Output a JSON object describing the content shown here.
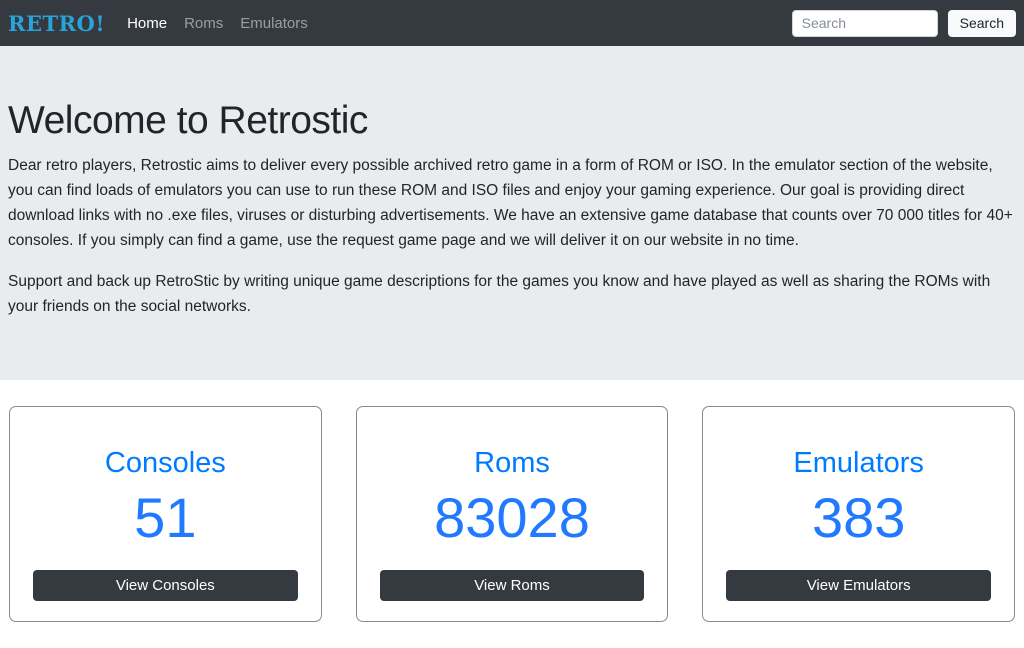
{
  "navbar": {
    "logo": "RETRO!",
    "links": [
      {
        "label": "Home",
        "active": true
      },
      {
        "label": "Roms",
        "active": false
      },
      {
        "label": "Emulators",
        "active": false
      }
    ],
    "search": {
      "placeholder": "Search",
      "value": "",
      "button_label": "Search"
    }
  },
  "jumbotron": {
    "title": "Welcome to Retrostic",
    "paragraph1": "Dear retro players, Retrostic aims to deliver every possible archived retro game in a form of ROM or ISO. In the emulator section of the website, you can find loads of emulators you can use to run these ROM and ISO files and enjoy your gaming experience. Our goal is providing direct download links with no .exe files, viruses or disturbing advertisements. We have an extensive game database that counts over 70 000 titles for 40+ consoles. If you simply can find a game, use the request game page and we will deliver it on our website in no time.",
    "paragraph2": "Support and back up RetroStic by writing unique game descriptions for the games you know and have played as well as sharing the ROMs with your friends on the social networks."
  },
  "cards": [
    {
      "title": "Consoles",
      "count": "51",
      "button_label": "View Consoles"
    },
    {
      "title": "Roms",
      "count": "83028",
      "button_label": "View Roms"
    },
    {
      "title": "Emulators",
      "count": "383",
      "button_label": "View Emulators"
    }
  ],
  "colors": {
    "navbar_bg": "#343a40",
    "logo_cyan": "#29a3d8",
    "jumbotron_bg": "#e9ecef",
    "accent_blue": "#007bff",
    "button_dark": "#343a40"
  }
}
